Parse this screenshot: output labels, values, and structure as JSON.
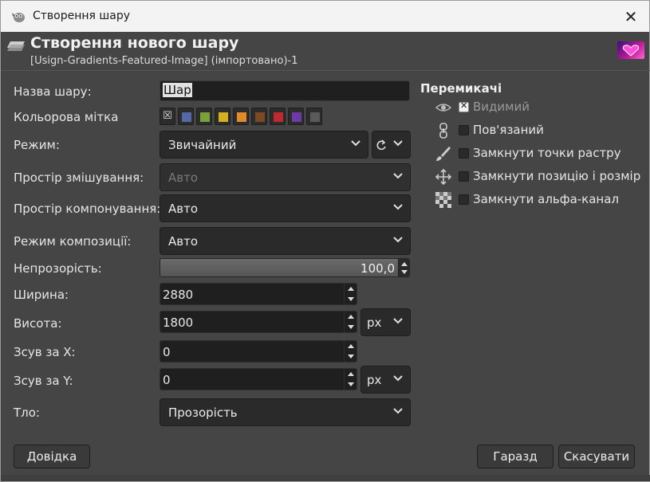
{
  "window": {
    "title": "Створення шару"
  },
  "header": {
    "title": "Створення нового шару",
    "subtitle": "[Usign-Gradients-Featured-Image] (імпортовано)-1"
  },
  "form": {
    "name_label": "Назва шару:",
    "name_value": "Шар",
    "color_tag_label": "Кольорова мітка",
    "color_tags": [
      {
        "name": "none",
        "color": "#2c2c2c"
      },
      {
        "name": "blue",
        "color": "#5468a8"
      },
      {
        "name": "green",
        "color": "#7aa03c"
      },
      {
        "name": "yellow",
        "color": "#d4b020"
      },
      {
        "name": "orange",
        "color": "#e08a2a"
      },
      {
        "name": "brown",
        "color": "#7a4a24"
      },
      {
        "name": "red",
        "color": "#c02a2e"
      },
      {
        "name": "violet",
        "color": "#6e3aa8"
      },
      {
        "name": "gray",
        "color": "#5a5a5a"
      }
    ],
    "mode_label": "Режим:",
    "mode_value": "Звичайний",
    "blend_space_label": "Простір змішування:",
    "blend_space_value": "Авто",
    "composite_space_label": "Простір компонування:",
    "composite_space_value": "Авто",
    "composite_mode_label": "Режим композиції:",
    "composite_mode_value": "Авто",
    "opacity_label": "Непрозорість:",
    "opacity_value": "100,0",
    "opacity_fraction": 1.0,
    "width_label": "Ширина:",
    "width_value": "2880",
    "height_label": "Висота:",
    "height_value": "1800",
    "size_unit": "px",
    "offset_x_label": "Зсув за X:",
    "offset_x_value": "0",
    "offset_y_label": "Зсув за Y:",
    "offset_y_value": "0",
    "offset_unit": "px",
    "fill_label": "Тло:",
    "fill_value": "Прозорість"
  },
  "switches": {
    "title": "Перемикачі",
    "items": [
      {
        "label": "Видимий",
        "checked": true,
        "icon": "eye-icon"
      },
      {
        "label": "Пов'язаний",
        "checked": false,
        "icon": "chain-icon"
      },
      {
        "label": "Замкнути точки растру",
        "checked": false,
        "icon": "brush-icon"
      },
      {
        "label": "Замкнути позицію і розмір",
        "checked": false,
        "icon": "move-icon"
      },
      {
        "label": "Замкнути альфа-канал",
        "checked": false,
        "icon": "checkerboard-icon"
      }
    ]
  },
  "buttons": {
    "help": "Довідка",
    "ok": "Гаразд",
    "cancel": "Скасувати"
  },
  "icons": {
    "close": "✕"
  }
}
